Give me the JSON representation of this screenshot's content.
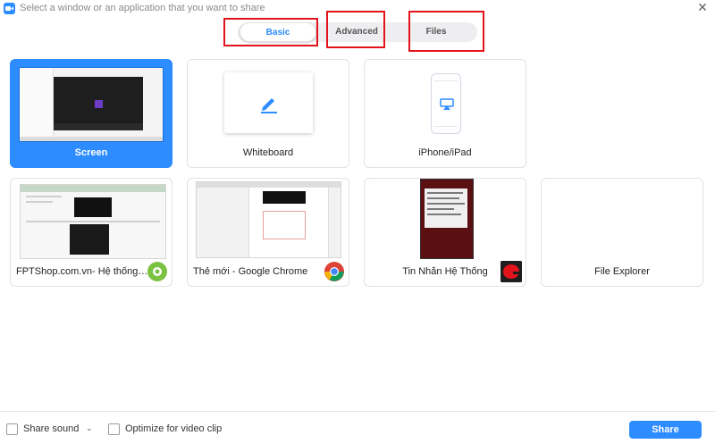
{
  "window": {
    "title": "Select a window or an application that you want to share",
    "close_glyph": "✕"
  },
  "tabs": [
    {
      "label": "Basic",
      "active": true
    },
    {
      "label": "Advanced",
      "active": false
    },
    {
      "label": "Files",
      "active": false
    }
  ],
  "sources": [
    {
      "label": "Screen",
      "selected": true,
      "thumbnail": "screen-preview"
    },
    {
      "label": "Whiteboard",
      "selected": false,
      "icon": "pen-icon"
    },
    {
      "label": "iPhone/iPad",
      "selected": false,
      "icon": "airplay-icon"
    },
    {
      "label": "FPTShop.com.vn- Hệ thống quả...",
      "selected": false,
      "app_icon": "coc-coc-browser-icon"
    },
    {
      "label": "Thẻ mới - Google Chrome",
      "selected": false,
      "app_icon": "chrome-icon"
    },
    {
      "label": "Tin Nhắn Hệ Thống",
      "selected": false,
      "app_icon": "garena-icon"
    },
    {
      "label": "File Explorer",
      "selected": false
    }
  ],
  "footer": {
    "share_sound_label": "Share sound",
    "optimize_label": "Optimize for video clip",
    "share_button_label": "Share"
  },
  "colors": {
    "accent": "#2d8cff",
    "highlight_box": "#e3131b"
  }
}
